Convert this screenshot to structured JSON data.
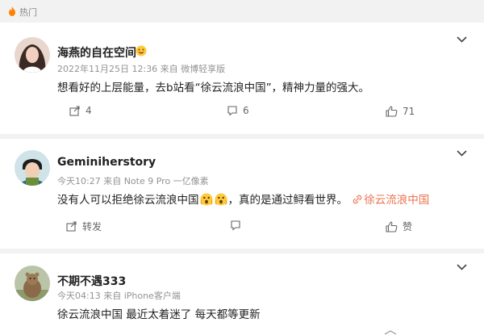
{
  "section": {
    "label": "热门"
  },
  "comments": [
    {
      "username": "海燕的自在空间",
      "meta": "2022年11月25日 12:36 来自 微博轻享版",
      "text": "想看好的上层能量，去b站看“徐云流浪中国”，精神力量的强大。",
      "actions": {
        "share": "4",
        "comments": "6",
        "likes": "71"
      }
    },
    {
      "username": "Geminiherstory",
      "meta": "今天10:27 来自 Note 9 Pro 一亿像素",
      "text_before": "没有人可以拒绝徐云流浪中国",
      "text_after": "，真的是通过鲟看世界。",
      "topic": "徐云流浪中国",
      "actions": {
        "share": "转发",
        "likes": "赞"
      }
    },
    {
      "username": "不期不遇333",
      "meta": "今天04:13 来自 iPhone客户端",
      "text": "徐云流浪中国 最近太着迷了 每天都等更新"
    }
  ],
  "colors": {
    "accent": "#eb7350",
    "meta": "#939393",
    "background": "#f2f2f2"
  }
}
